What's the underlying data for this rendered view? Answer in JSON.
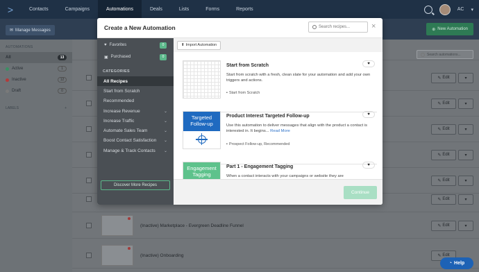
{
  "nav": {
    "items": [
      "Contacts",
      "Campaigns",
      "Automations",
      "Deals",
      "Lists",
      "Forms",
      "Reports"
    ],
    "active_index": 2,
    "user_initials": "AC",
    "user_caret": "▾"
  },
  "subbar": {
    "manage_label": "Manage Messages",
    "new_label": "New Automation"
  },
  "left": {
    "title": "AUTOMATIONS",
    "items": [
      {
        "label": "All",
        "count": "13",
        "color": ""
      },
      {
        "label": "Active",
        "count": "1",
        "color": "#3b8f63"
      },
      {
        "label": "Inactive",
        "count": "12",
        "color": "#b43a3a"
      },
      {
        "label": "Draft",
        "count": "0",
        "color": "#7a7a7a"
      }
    ],
    "labels_title": "LABELS",
    "labels_add": "+"
  },
  "list": {
    "search_placeholder": "Search automations...",
    "edit_label": "Edit",
    "rows": [
      {
        "name": ""
      },
      {
        "name": ""
      },
      {
        "name": ""
      },
      {
        "name": ""
      },
      {
        "name": ""
      },
      {
        "name": ""
      },
      {
        "name": ""
      },
      {
        "name": "(Inactive) Marketplace - Evergreen Deadline Funnel"
      },
      {
        "name": "(Inactive) Onboarding"
      }
    ]
  },
  "modal": {
    "title": "Create a New Automation",
    "search_placeholder": "Search recipes...",
    "close": "×",
    "favorites_label": "Favorites",
    "favorites_count": "0",
    "purchased_label": "Purchased",
    "purchased_count": "0",
    "categories_title": "CATEGORIES",
    "categories": [
      {
        "label": "All Recipes",
        "chevron": ""
      },
      {
        "label": "Start from Scratch",
        "chevron": ""
      },
      {
        "label": "Recommended",
        "chevron": ""
      },
      {
        "label": "Increase Revenue",
        "chevron": "⌄"
      },
      {
        "label": "Increase Traffic",
        "chevron": "⌄"
      },
      {
        "label": "Automate Sales Team",
        "chevron": "⌄"
      },
      {
        "label": "Boost Contact Satisfaction",
        "chevron": "⌄"
      },
      {
        "label": "Manage & Track Contacts",
        "chevron": "⌄"
      }
    ],
    "discover_label": "Discover More Recipes",
    "import_label": "Import Automation",
    "continue_label": "Continue",
    "cards": [
      {
        "title": "Start from Scratch",
        "desc": "Start from scratch with a fresh, clean slate for your automation and add your own triggers and actions.",
        "more": "",
        "tag": "Start from Scratch"
      },
      {
        "title": "Product Interest Targeted Follow-up",
        "thumb_text": "Targeted Follow-up",
        "desc": "Use this automation to deliver messages that align with the product a contact is interested in. It begins...",
        "more": "Read More",
        "tag": "Prospect Follow-up, Recommended"
      },
      {
        "title": "Part 1 - Engagement Tagging",
        "thumb_text": "Engagement Tagging",
        "desc": "When a contact interacts with your campaigns or website they are",
        "more": "",
        "tag": ""
      }
    ]
  },
  "help_label": "Help",
  "colors": {
    "nav_bg": "#1f3146",
    "accent_green": "#5cb98b",
    "accent_blue": "#1f6ac0"
  }
}
